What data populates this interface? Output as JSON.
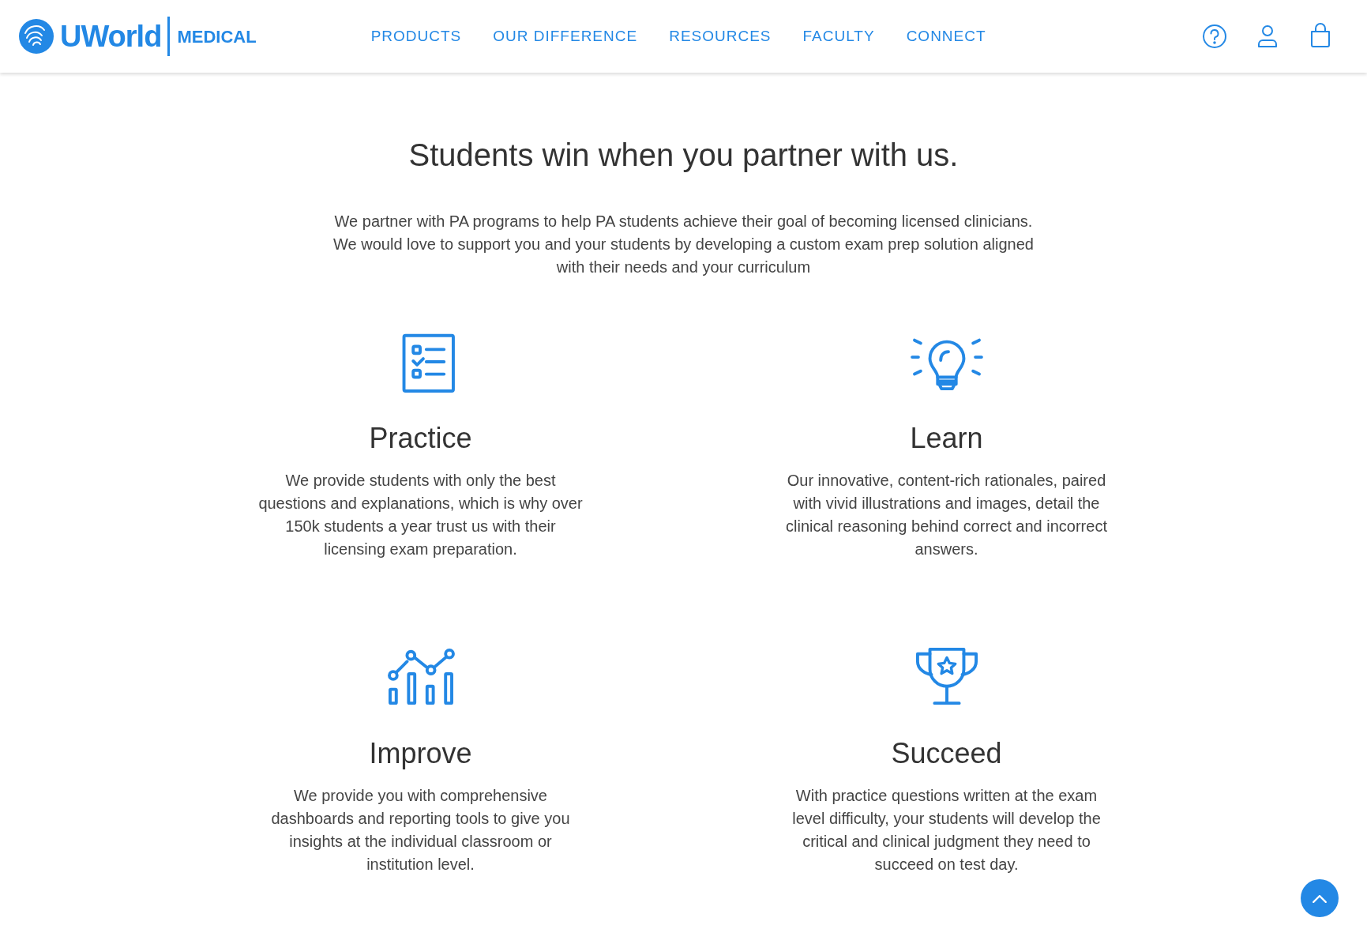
{
  "header": {
    "logo_text": "UWorld",
    "logo_subtext": "MEDICAL",
    "nav": [
      {
        "label": "PRODUCTS"
      },
      {
        "label": "OUR DIFFERENCE"
      },
      {
        "label": "RESOURCES"
      },
      {
        "label": "FACULTY"
      },
      {
        "label": "CONNECT"
      }
    ]
  },
  "heading": "Students win when you partner with us.",
  "intro": "We partner with PA programs to help PA students achieve their goal of becoming licensed clinicians. We would love to support you and your students by developing a custom exam prep solution aligned with their needs and your curriculum",
  "features": [
    {
      "kind": "checklist",
      "title": "Practice",
      "text": "We provide students with only the best questions and explanations, which is why over 150k students a year trust us with their licensing exam preparation."
    },
    {
      "kind": "bulb",
      "title": "Learn",
      "text": "Our innovative, content-rich rationales, paired with vivid illustrations and images, detail the clinical reasoning behind correct and incorrect answers."
    },
    {
      "kind": "chart",
      "title": "Improve",
      "text": "We provide you with comprehensive dashboards and reporting tools to give you insights at the individual classroom or institution level."
    },
    {
      "kind": "trophy",
      "title": "Succeed",
      "text": "With practice questions written at the exam level difficulty, your students will develop the critical and clinical judgment they need to succeed on test day."
    }
  ]
}
